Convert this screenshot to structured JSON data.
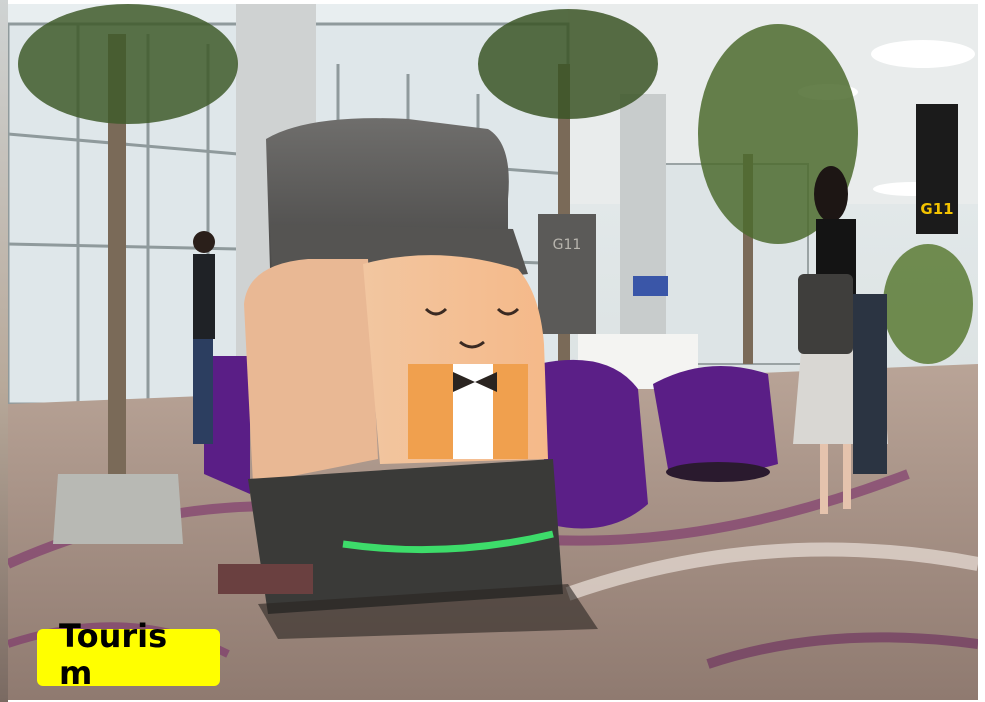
{
  "caption": {
    "label": "Tourism",
    "color": "#ffff00"
  },
  "scene": {
    "gate_sign": "G11",
    "gate_panel": "G11"
  }
}
